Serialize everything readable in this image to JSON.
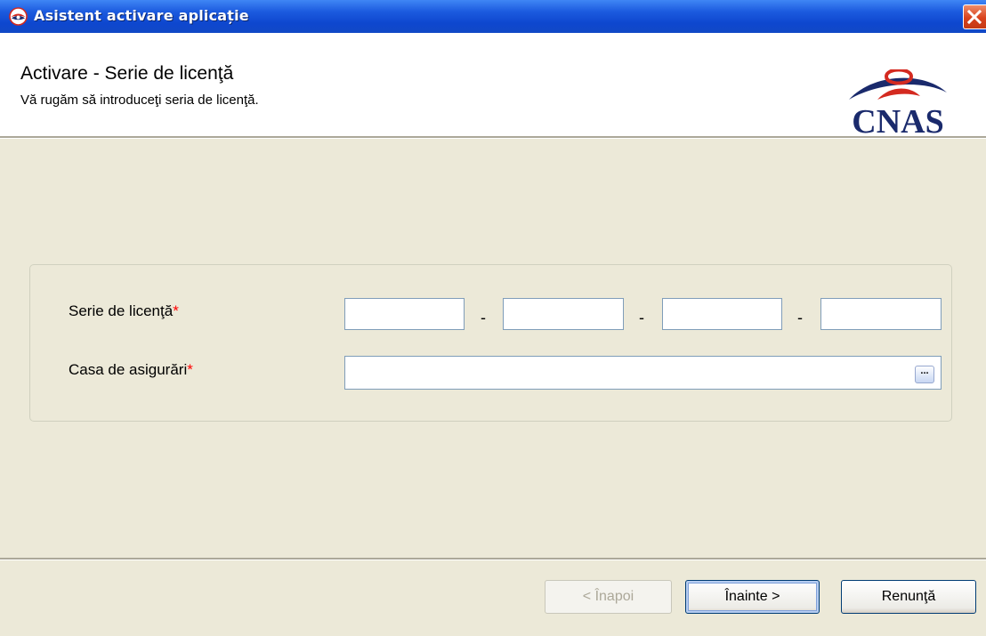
{
  "window": {
    "title": "Asistent activare aplicație"
  },
  "header": {
    "title": "Activare - Serie de licenţă",
    "subtitle": "Vă rugăm să introduceţi seria de licenţă.",
    "logo_text": "CNAS"
  },
  "form": {
    "license_label": "Serie de licenţă",
    "insurance_label": "Casa de asigurări",
    "required_marker": "*",
    "separator": "-",
    "license_parts": [
      "",
      "",
      "",
      ""
    ],
    "insurance_value": "",
    "browse_label": "..."
  },
  "footer": {
    "back_label": "< Înapoi",
    "next_label": "Înainte >",
    "cancel_label": "Renunţă"
  },
  "colors": {
    "titlebar": "#0e47cf",
    "background": "#ece9d8",
    "required": "#ff0000",
    "logo_navy": "#1a2a6c",
    "logo_red": "#d42a20"
  }
}
